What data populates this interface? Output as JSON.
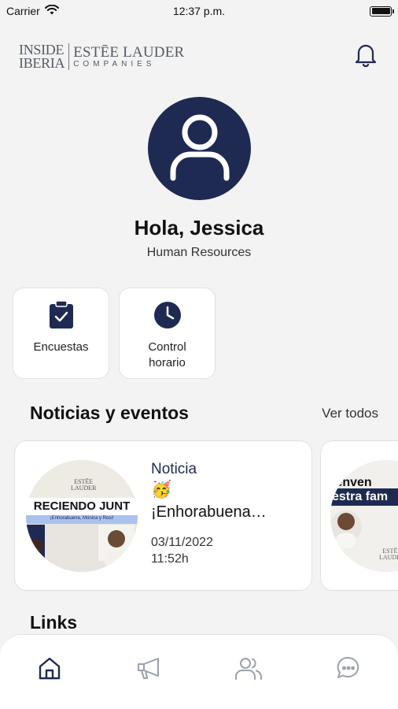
{
  "status_bar": {
    "carrier": "Carrier",
    "time": "12:37 p.m."
  },
  "brand": {
    "logo_left_line1": "INSIDE",
    "logo_left_line2": "IBERIA",
    "logo_right_line1": "ESTĒE LAUDER",
    "logo_right_line2": "COMPANIES"
  },
  "profile": {
    "greeting": "Hola, Jessica",
    "department": "Human Resources"
  },
  "quick_actions": [
    {
      "label": "Encuestas",
      "icon": "clipboard-check-icon"
    },
    {
      "label": "Control horario",
      "icon": "clock-icon"
    }
  ],
  "news": {
    "section_title": "Noticias y eventos",
    "see_all": "Ver todos",
    "items": [
      {
        "type": "Noticia",
        "emoji": "🥳",
        "title": "¡Enhorabuena…",
        "date": "03/11/2022",
        "time": "11:52h",
        "thumb_brand_line1": "ESTĒE",
        "thumb_brand_line2": "LAUDER",
        "thumb_headline": "RECIENDO JUNT",
        "thumb_subline": "¡Enhorabuena, Mónica y Rosi!"
      },
      {
        "thumb_line1": "ienven",
        "thumb_line2": "estra fam",
        "thumb_brand_line1": "ESTĒE",
        "thumb_brand_line2": "LAUDER"
      }
    ]
  },
  "links": {
    "section_title": "Links"
  },
  "tab_bar": [
    {
      "icon": "home-icon",
      "active": true
    },
    {
      "icon": "megaphone-icon",
      "active": false
    },
    {
      "icon": "users-icon",
      "active": false
    },
    {
      "icon": "chat-bubble-icon",
      "active": false
    }
  ],
  "colors": {
    "accent": "#1e2a52",
    "inactive": "#9aa0ad",
    "background": "#f3f3f3"
  }
}
